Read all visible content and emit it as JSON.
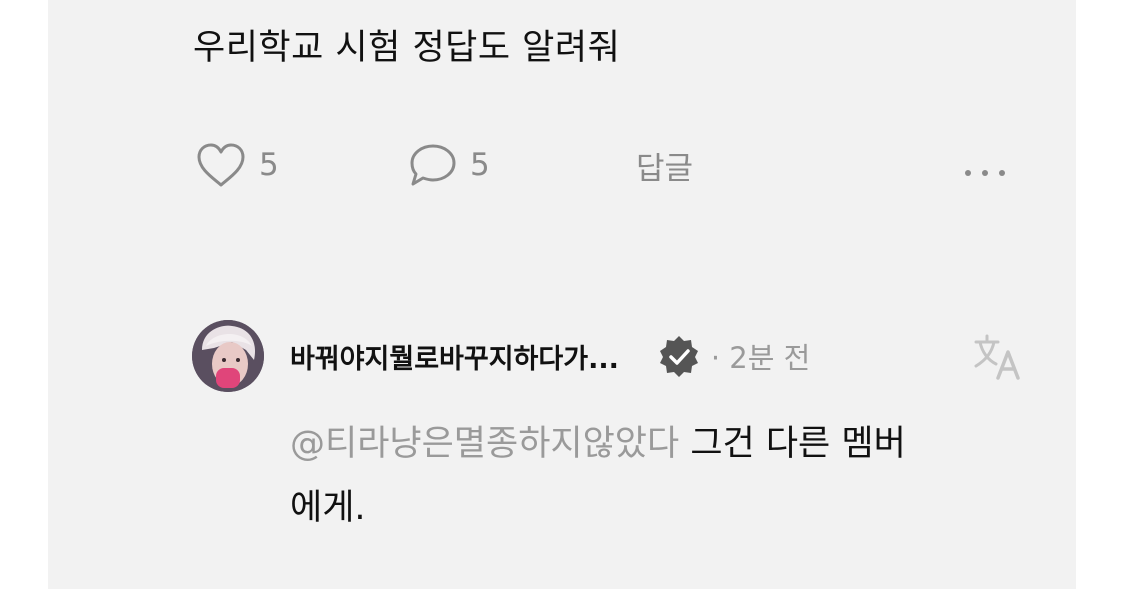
{
  "post": {
    "text": "우리학교 시험 정답도 알려줘",
    "likes": "5",
    "comments": "5",
    "reply_label": "답글"
  },
  "reply": {
    "username": "바꿔야지뭘로바꾸지하다가...",
    "time": "· 2분 전",
    "mention": "@티라냥은멸종하지않았다",
    "text_line1": " 그건 다른 멤버",
    "text_line2": "에게."
  },
  "colors": {
    "panel": "#f2f2f2",
    "text": "#111111",
    "muted": "#8a8a8a",
    "badge": "#555555"
  },
  "icons": [
    "heart-icon",
    "comment-icon",
    "more-icon",
    "verified-icon",
    "translate-icon"
  ]
}
